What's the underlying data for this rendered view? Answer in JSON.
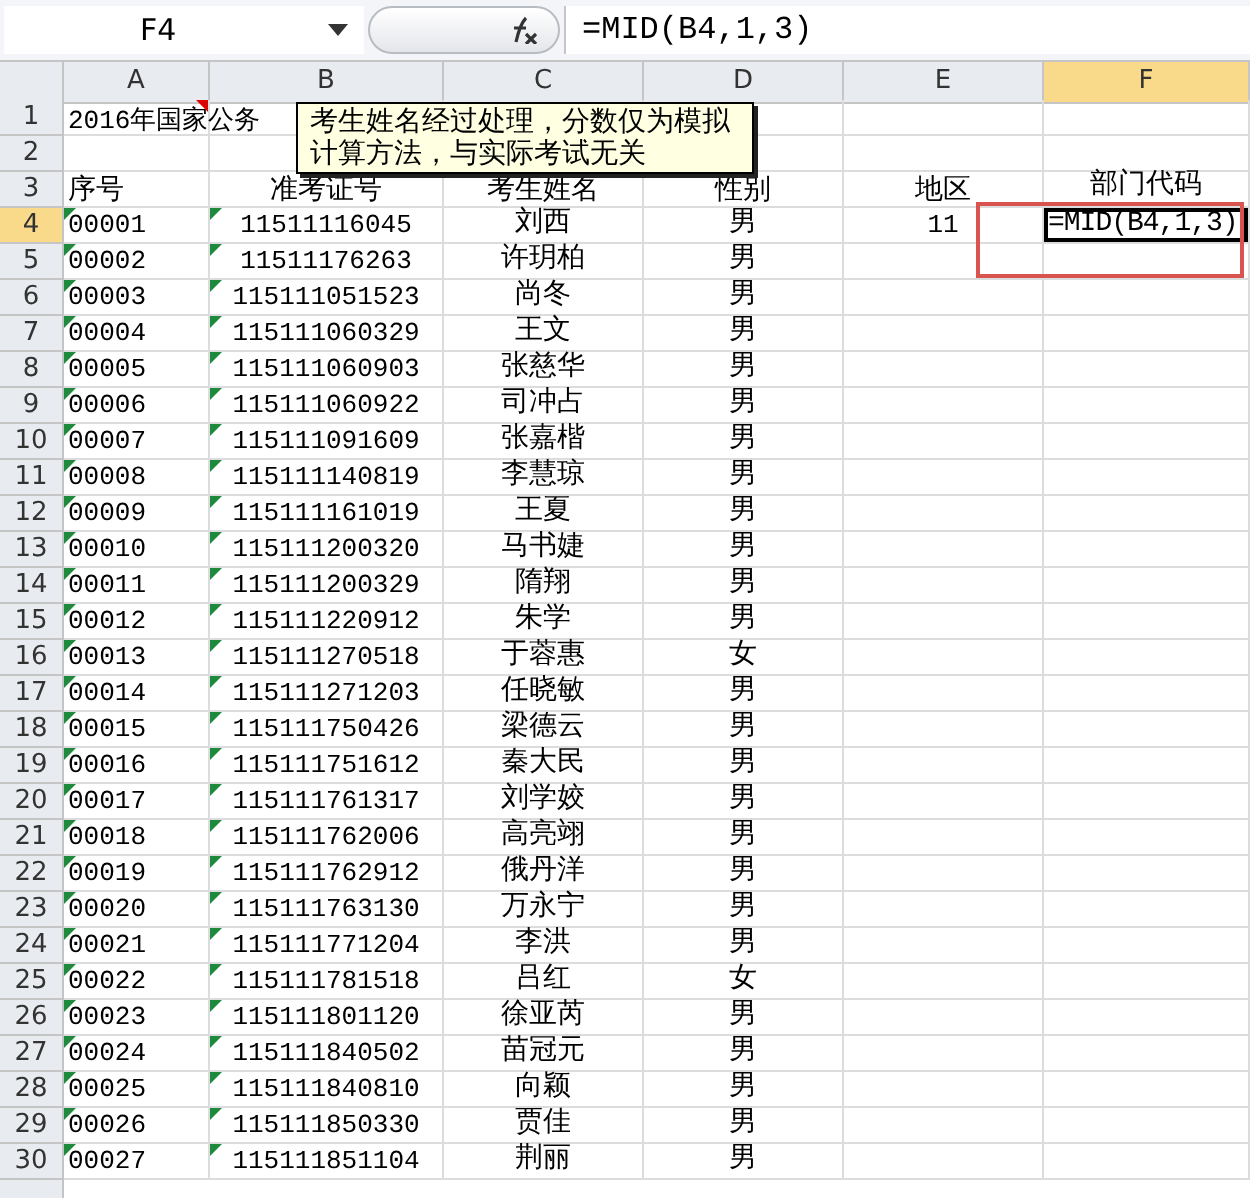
{
  "formula_bar": {
    "name_box": "F4",
    "formula": "=MID(B4,1,3)"
  },
  "columns": [
    {
      "label": "A",
      "selected": false
    },
    {
      "label": "B",
      "selected": false
    },
    {
      "label": "C",
      "selected": false
    },
    {
      "label": "D",
      "selected": false
    },
    {
      "label": "E",
      "selected": false
    },
    {
      "label": "F",
      "selected": true
    }
  ],
  "title_row": {
    "number": "1",
    "text": "2016年国家公务"
  },
  "blank_row": {
    "number": "2"
  },
  "header_row": {
    "number": "3",
    "cells": [
      "序号",
      "准考证号",
      "考生姓名",
      "性别",
      "地区",
      "部门代码"
    ]
  },
  "rows": [
    {
      "number": "4",
      "selected": true,
      "id": "00001",
      "exam_no": "11511116045",
      "name": "刘西",
      "gender": "男",
      "region": "11",
      "dept_code": "=MID(B4,1,3)",
      "text_flag": true
    },
    {
      "number": "5",
      "selected": false,
      "id": "00002",
      "exam_no": "11511176263",
      "name": "许玥柏",
      "gender": "男",
      "text_flag": true
    },
    {
      "number": "6",
      "selected": false,
      "id": "00003",
      "exam_no": "115111051523",
      "name": "尚冬",
      "gender": "男",
      "text_flag": true
    },
    {
      "number": "7",
      "selected": false,
      "id": "00004",
      "exam_no": "115111060329",
      "name": "王文",
      "gender": "男",
      "text_flag": true
    },
    {
      "number": "8",
      "selected": false,
      "id": "00005",
      "exam_no": "115111060903",
      "name": "张慈华",
      "gender": "男",
      "text_flag": true
    },
    {
      "number": "9",
      "selected": false,
      "id": "00006",
      "exam_no": "115111060922",
      "name": "司冲占",
      "gender": "男",
      "text_flag": true
    },
    {
      "number": "10",
      "selected": false,
      "id": "00007",
      "exam_no": "115111091609",
      "name": "张嘉楷",
      "gender": "男",
      "text_flag": true
    },
    {
      "number": "11",
      "selected": false,
      "id": "00008",
      "exam_no": "115111140819",
      "name": "李慧琼",
      "gender": "男",
      "text_flag": true
    },
    {
      "number": "12",
      "selected": false,
      "id": "00009",
      "exam_no": "115111161019",
      "name": "王夏",
      "gender": "男",
      "text_flag": true
    },
    {
      "number": "13",
      "selected": false,
      "id": "00010",
      "exam_no": "115111200320",
      "name": "马书婕",
      "gender": "男",
      "text_flag": true
    },
    {
      "number": "14",
      "selected": false,
      "id": "00011",
      "exam_no": "115111200329",
      "name": "隋翔",
      "gender": "男",
      "text_flag": true
    },
    {
      "number": "15",
      "selected": false,
      "id": "00012",
      "exam_no": "115111220912",
      "name": "朱学",
      "gender": "男",
      "text_flag": true
    },
    {
      "number": "16",
      "selected": false,
      "id": "00013",
      "exam_no": "115111270518",
      "name": "于蓉惠",
      "gender": "女",
      "text_flag": true
    },
    {
      "number": "17",
      "selected": false,
      "id": "00014",
      "exam_no": "115111271203",
      "name": "任晓敏",
      "gender": "男",
      "text_flag": true
    },
    {
      "number": "18",
      "selected": false,
      "id": "00015",
      "exam_no": "115111750426",
      "name": "梁德云",
      "gender": "男",
      "text_flag": true
    },
    {
      "number": "19",
      "selected": false,
      "id": "00016",
      "exam_no": "115111751612",
      "name": "秦大民",
      "gender": "男",
      "text_flag": true
    },
    {
      "number": "20",
      "selected": false,
      "id": "00017",
      "exam_no": "115111761317",
      "name": "刘学姣",
      "gender": "男",
      "text_flag": true
    },
    {
      "number": "21",
      "selected": false,
      "id": "00018",
      "exam_no": "115111762006",
      "name": "高亮翊",
      "gender": "男",
      "text_flag": true
    },
    {
      "number": "22",
      "selected": false,
      "id": "00019",
      "exam_no": "115111762912",
      "name": "俄丹洋",
      "gender": "男",
      "text_flag": true
    },
    {
      "number": "23",
      "selected": false,
      "id": "00020",
      "exam_no": "115111763130",
      "name": "万永宁",
      "gender": "男",
      "text_flag": true
    },
    {
      "number": "24",
      "selected": false,
      "id": "00021",
      "exam_no": "115111771204",
      "name": "李洪",
      "gender": "男",
      "text_flag": true
    },
    {
      "number": "25",
      "selected": false,
      "id": "00022",
      "exam_no": "115111781518",
      "name": "吕红",
      "gender": "女",
      "text_flag": true
    },
    {
      "number": "26",
      "selected": false,
      "id": "00023",
      "exam_no": "115111801120",
      "name": "徐亚芮",
      "gender": "男",
      "text_flag": true
    },
    {
      "number": "27",
      "selected": false,
      "id": "00024",
      "exam_no": "115111840502",
      "name": "苗冠元",
      "gender": "男",
      "text_flag": true
    },
    {
      "number": "28",
      "selected": false,
      "id": "00025",
      "exam_no": "115111840810",
      "name": "向颖",
      "gender": "男",
      "text_flag": true
    },
    {
      "number": "29",
      "selected": false,
      "id": "00026",
      "exam_no": "115111850330",
      "name": "贾佳",
      "gender": "男",
      "text_flag": true
    },
    {
      "number": "30",
      "selected": false,
      "id": "00027",
      "exam_no": "115111851104",
      "name": "荆丽",
      "gender": "男",
      "text_flag": true
    }
  ],
  "comment": {
    "text": "考生姓名经过处理，分数仅为模拟计算方法，与实际考试无关"
  }
}
